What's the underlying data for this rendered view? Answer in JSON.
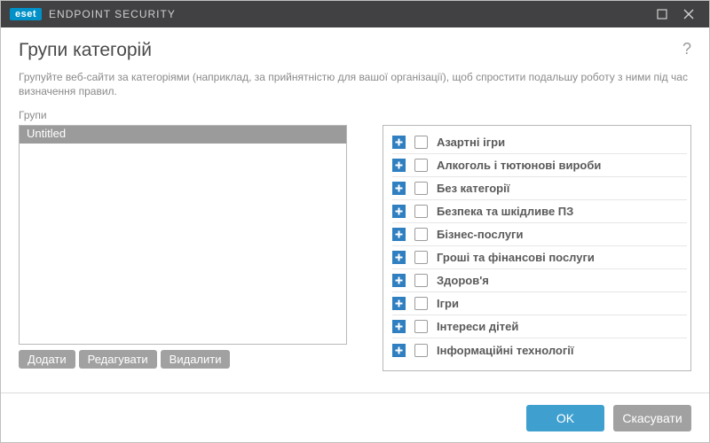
{
  "titlebar": {
    "logo": "eset",
    "product": "ENDPOINT SECURITY"
  },
  "header": {
    "title": "Групи категорій",
    "help_label": "?"
  },
  "description": "Групуйте веб-сайти за категоріями (наприклад, за прийнятністю для вашої організації), щоб спростити подальшу роботу з ними під час визначення правил.",
  "groups": {
    "label": "Групи",
    "items": [
      {
        "name": "Untitled"
      }
    ]
  },
  "group_actions": {
    "add": "Додати",
    "edit": "Редагувати",
    "delete": "Видалити"
  },
  "categories": [
    {
      "label": "Азартні ігри",
      "checked": false
    },
    {
      "label": "Алкоголь і тютюнові вироби",
      "checked": false
    },
    {
      "label": "Без категорії",
      "checked": false
    },
    {
      "label": "Безпека та шкідливе ПЗ",
      "checked": false
    },
    {
      "label": "Бізнес-послуги",
      "checked": false
    },
    {
      "label": "Гроші та фінансові послуги",
      "checked": false
    },
    {
      "label": "Здоров'я",
      "checked": false
    },
    {
      "label": "Ігри",
      "checked": false
    },
    {
      "label": "Інтереси дітей",
      "checked": false
    },
    {
      "label": "Інформаційні технології",
      "checked": false
    }
  ],
  "footer": {
    "ok": "OK",
    "cancel": "Скасувати"
  }
}
